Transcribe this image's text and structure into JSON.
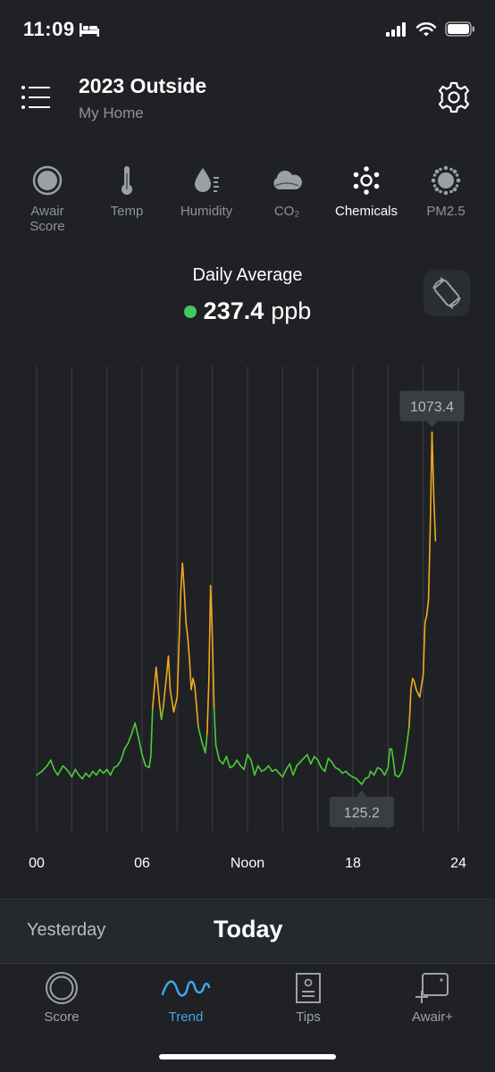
{
  "status_bar": {
    "time": "11:09"
  },
  "header": {
    "title": "2023 Outside",
    "subtitle": "My Home"
  },
  "metric_tabs": [
    {
      "label": "Awair\nScore",
      "icon": "awair-score-icon",
      "active": false
    },
    {
      "label": "Temp",
      "icon": "thermometer-icon",
      "active": false
    },
    {
      "label": "Humidity",
      "icon": "humidity-drop-icon",
      "active": false
    },
    {
      "label": "CO₂",
      "icon": "co2-cloud-icon",
      "active": false
    },
    {
      "label": "Chemicals",
      "icon": "chemicals-icon",
      "active": true
    },
    {
      "label": "PM2.5",
      "icon": "pm25-icon",
      "active": false
    }
  ],
  "summary": {
    "label": "Daily Average",
    "value": "237.4",
    "unit": "ppb",
    "status_color": "#42c95a"
  },
  "chart_data": {
    "type": "line",
    "xlabel": "",
    "ylabel": "",
    "x_ticks": [
      "00",
      "06",
      "Noon",
      "18",
      "24"
    ],
    "x_range": [
      0,
      24
    ],
    "y_range": [
      0,
      1250
    ],
    "good_color": "#4ecb3a",
    "moderate_color": "#f2a91f",
    "threshold": 333,
    "max_annotation": {
      "label": "1073.4",
      "x": 22.5,
      "y": 1073.4
    },
    "min_annotation": {
      "label": "125.2",
      "x": 18.5,
      "y": 125.2
    },
    "series": [
      {
        "points": [
          [
            0.0,
            150
          ],
          [
            0.3,
            160
          ],
          [
            0.6,
            175
          ],
          [
            0.8,
            190
          ],
          [
            1.0,
            165
          ],
          [
            1.2,
            150
          ],
          [
            1.5,
            175
          ],
          [
            1.8,
            160
          ],
          [
            2.0,
            145
          ],
          [
            2.2,
            165
          ],
          [
            2.4,
            150
          ],
          [
            2.6,
            140
          ],
          [
            2.8,
            155
          ],
          [
            3.0,
            145
          ],
          [
            3.2,
            160
          ],
          [
            3.4,
            150
          ],
          [
            3.6,
            165
          ],
          [
            3.8,
            155
          ],
          [
            4.0,
            165
          ],
          [
            4.2,
            150
          ],
          [
            4.4,
            170
          ],
          [
            4.6,
            175
          ],
          [
            4.8,
            190
          ],
          [
            5.0,
            220
          ],
          [
            5.2,
            235
          ],
          [
            5.4,
            260
          ],
          [
            5.6,
            290
          ],
          [
            5.8,
            250
          ],
          [
            6.0,
            205
          ],
          [
            6.2,
            175
          ],
          [
            6.4,
            170
          ],
          [
            6.5,
            200
          ],
          [
            6.6,
            330
          ],
          [
            6.8,
            440
          ],
          [
            7.0,
            340
          ],
          [
            7.1,
            300
          ],
          [
            7.2,
            330
          ],
          [
            7.4,
            420
          ],
          [
            7.5,
            470
          ],
          [
            7.6,
            380
          ],
          [
            7.8,
            320
          ],
          [
            8.0,
            360
          ],
          [
            8.1,
            500
          ],
          [
            8.2,
            640
          ],
          [
            8.3,
            720
          ],
          [
            8.4,
            650
          ],
          [
            8.5,
            560
          ],
          [
            8.6,
            520
          ],
          [
            8.7,
            460
          ],
          [
            8.8,
            380
          ],
          [
            8.9,
            410
          ],
          [
            9.0,
            390
          ],
          [
            9.2,
            280
          ],
          [
            9.4,
            240
          ],
          [
            9.6,
            210
          ],
          [
            9.7,
            260
          ],
          [
            9.8,
            400
          ],
          [
            9.9,
            660
          ],
          [
            10.0,
            520
          ],
          [
            10.1,
            330
          ],
          [
            10.2,
            230
          ],
          [
            10.4,
            190
          ],
          [
            10.6,
            180
          ],
          [
            10.8,
            200
          ],
          [
            11.0,
            170
          ],
          [
            11.2,
            175
          ],
          [
            11.4,
            190
          ],
          [
            11.6,
            175
          ],
          [
            11.8,
            165
          ],
          [
            12.0,
            205
          ],
          [
            12.2,
            190
          ],
          [
            12.4,
            150
          ],
          [
            12.6,
            175
          ],
          [
            12.8,
            160
          ],
          [
            13.0,
            165
          ],
          [
            13.2,
            175
          ],
          [
            13.4,
            160
          ],
          [
            13.6,
            165
          ],
          [
            13.8,
            155
          ],
          [
            14.0,
            145
          ],
          [
            14.2,
            165
          ],
          [
            14.4,
            180
          ],
          [
            14.6,
            150
          ],
          [
            14.8,
            175
          ],
          [
            15.0,
            185
          ],
          [
            15.2,
            195
          ],
          [
            15.4,
            205
          ],
          [
            15.6,
            180
          ],
          [
            15.8,
            200
          ],
          [
            16.0,
            190
          ],
          [
            16.2,
            170
          ],
          [
            16.4,
            160
          ],
          [
            16.6,
            195
          ],
          [
            16.8,
            185
          ],
          [
            17.0,
            170
          ],
          [
            17.2,
            165
          ],
          [
            17.4,
            155
          ],
          [
            17.6,
            160
          ],
          [
            17.8,
            150
          ],
          [
            18.0,
            145
          ],
          [
            18.2,
            140
          ],
          [
            18.4,
            130
          ],
          [
            18.5,
            125
          ],
          [
            18.7,
            140
          ],
          [
            18.9,
            145
          ],
          [
            19.0,
            160
          ],
          [
            19.2,
            150
          ],
          [
            19.4,
            170
          ],
          [
            19.6,
            165
          ],
          [
            19.8,
            150
          ],
          [
            20.0,
            170
          ],
          [
            20.1,
            220
          ],
          [
            20.2,
            220
          ],
          [
            20.3,
            190
          ],
          [
            20.4,
            150
          ],
          [
            20.6,
            145
          ],
          [
            20.8,
            160
          ],
          [
            21.0,
            210
          ],
          [
            21.2,
            280
          ],
          [
            21.3,
            380
          ],
          [
            21.4,
            410
          ],
          [
            21.5,
            400
          ],
          [
            21.6,
            380
          ],
          [
            21.8,
            360
          ],
          [
            21.9,
            390
          ],
          [
            22.0,
            420
          ],
          [
            22.1,
            560
          ],
          [
            22.2,
            580
          ],
          [
            22.3,
            620
          ],
          [
            22.4,
            820
          ],
          [
            22.5,
            1073
          ],
          [
            22.6,
            900
          ],
          [
            22.7,
            780
          ]
        ]
      }
    ]
  },
  "day_selector": {
    "yesterday": "Yesterday",
    "today": "Today"
  },
  "bottom_nav": [
    {
      "label": "Score",
      "icon": "score-ring-icon",
      "active": false
    },
    {
      "label": "Trend",
      "icon": "trend-wave-icon",
      "active": true
    },
    {
      "label": "Tips",
      "icon": "tips-document-icon",
      "active": false
    },
    {
      "label": "Awair+",
      "icon": "awair-plus-icon",
      "active": false
    }
  ]
}
